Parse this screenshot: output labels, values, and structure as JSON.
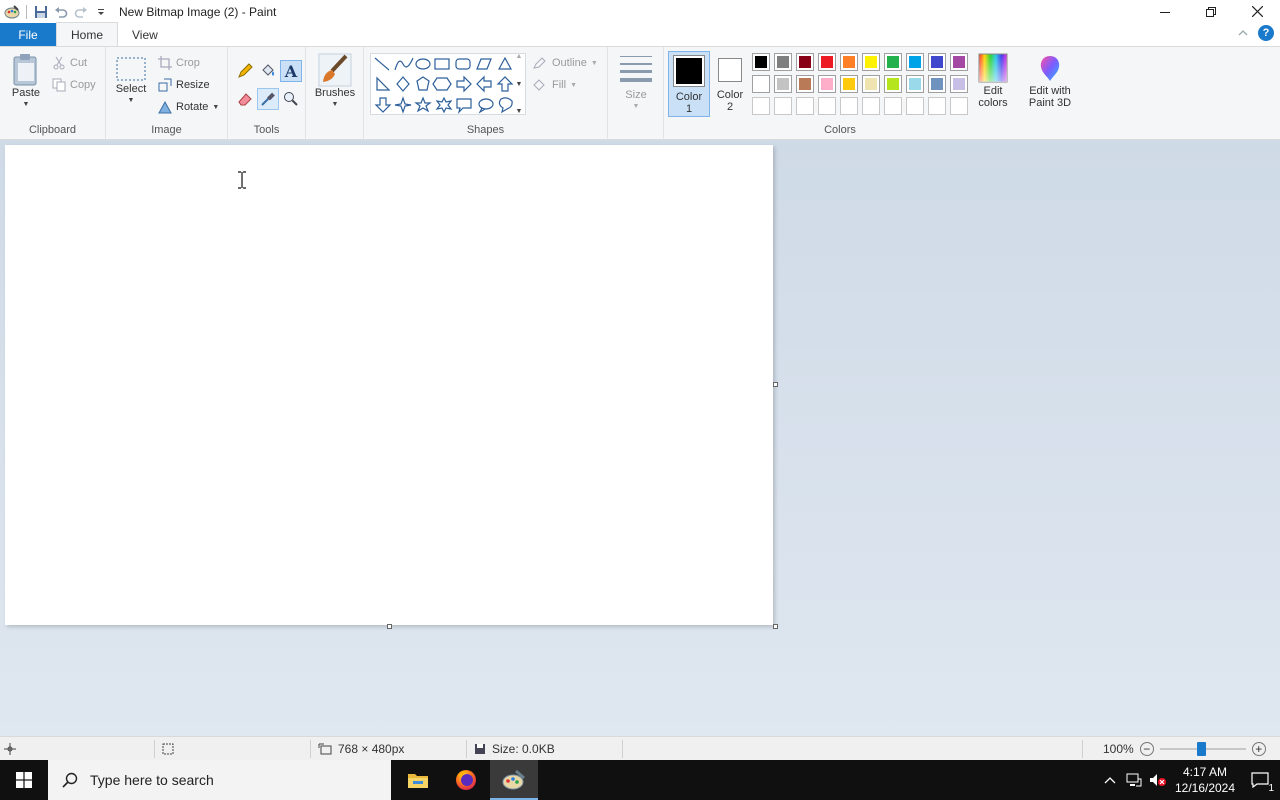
{
  "window": {
    "title": "New Bitmap Image (2) - Paint"
  },
  "tabs": {
    "file": "File",
    "home": "Home",
    "view": "View"
  },
  "ribbon": {
    "clipboard": {
      "label": "Clipboard",
      "paste": "Paste",
      "cut": "Cut",
      "copy": "Copy"
    },
    "image": {
      "label": "Image",
      "select": "Select",
      "crop": "Crop",
      "resize": "Resize",
      "rotate": "Rotate"
    },
    "tools": {
      "label": "Tools"
    },
    "brushes": {
      "label": "Brushes"
    },
    "shapes": {
      "label": "Shapes",
      "outline": "Outline",
      "fill": "Fill"
    },
    "size": {
      "label": "Size"
    },
    "colors": {
      "label": "Colors",
      "color1_line1": "Color",
      "color1_line2": "1",
      "color2_line1": "Color",
      "color2_line2": "2",
      "edit_line1": "Edit",
      "edit_line2": "colors",
      "paint3d_line1": "Edit with",
      "paint3d_line2": "Paint 3D",
      "color1_value": "#000000",
      "color2_value": "#ffffff",
      "palette_row1": [
        "#000000",
        "#7f7f7f",
        "#880015",
        "#ed1c24",
        "#ff7f27",
        "#fff200",
        "#22b14c",
        "#00a2e8",
        "#3f48cc",
        "#a349a4"
      ],
      "palette_row2": [
        "#ffffff",
        "#c3c3c3",
        "#b97a57",
        "#ffaec9",
        "#ffc90e",
        "#efe4b0",
        "#b5e61d",
        "#99d9ea",
        "#7092be",
        "#c8bfe7"
      ],
      "palette_row3": [
        "#ffffff",
        "#ffffff",
        "#ffffff",
        "#ffffff",
        "#ffffff",
        "#ffffff",
        "#ffffff",
        "#ffffff",
        "#ffffff",
        "#ffffff"
      ]
    }
  },
  "status": {
    "dimensions": "768 × 480px",
    "size": "Size: 0.0KB",
    "zoom": "100%"
  },
  "taskbar": {
    "search_placeholder": "Type here to search",
    "time": "4:17 AM",
    "date": "12/16/2024",
    "notification_count": "1"
  }
}
